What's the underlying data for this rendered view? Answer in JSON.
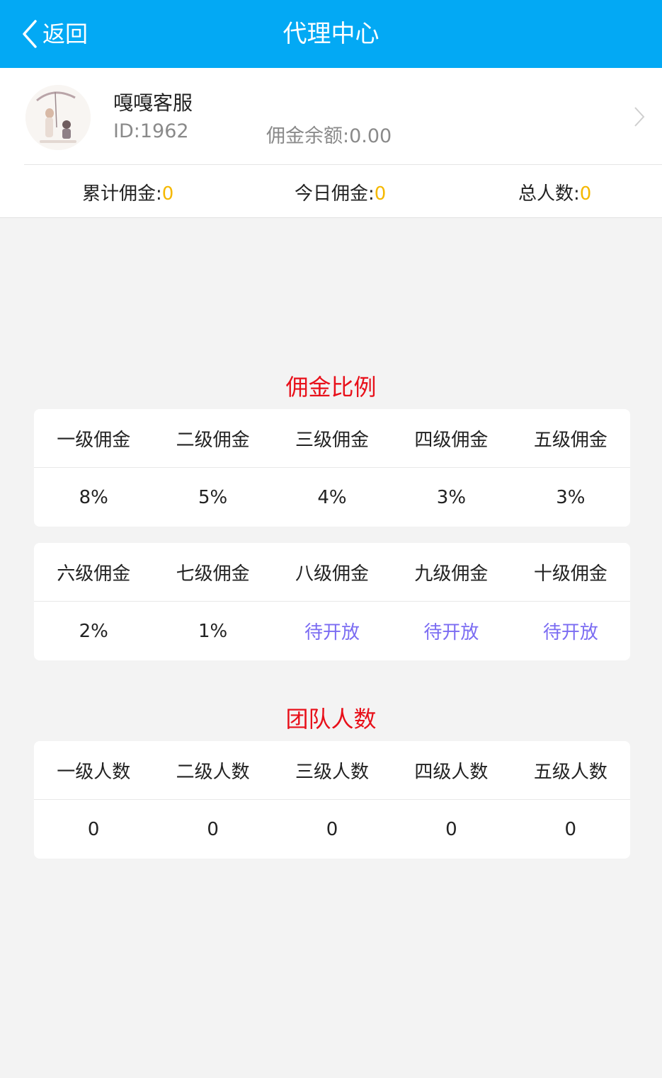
{
  "header": {
    "back_label": "返回",
    "title": "代理中心"
  },
  "profile": {
    "name": "嘎嘎客服",
    "id_text": "ID:1962",
    "balance_text": "佣金余额:0.00",
    "stats": [
      {
        "label": "累计佣金:",
        "value": "0"
      },
      {
        "label": "今日佣金:",
        "value": "0"
      },
      {
        "label": "总人数:",
        "value": "0"
      }
    ]
  },
  "commission": {
    "title": "佣金比例",
    "row1_headers": [
      "一级佣金",
      "二级佣金",
      "三级佣金",
      "四级佣金",
      "五级佣金"
    ],
    "row1_values": [
      "8%",
      "5%",
      "4%",
      "3%",
      "3%"
    ],
    "row2_headers": [
      "六级佣金",
      "七级佣金",
      "八级佣金",
      "九级佣金",
      "十级佣金"
    ],
    "row2_values": [
      "2%",
      "1%",
      "待开放",
      "待开放",
      "待开放"
    ]
  },
  "team": {
    "title": "团队人数",
    "headers": [
      "一级人数",
      "二级人数",
      "三级人数",
      "四级人数",
      "五级人数"
    ],
    "values": [
      "0",
      "0",
      "0",
      "0",
      "0"
    ]
  },
  "colors": {
    "header_bg": "#03a9f4",
    "stat_value": "#f5b800",
    "section_title": "#e8101a",
    "pending": "#7b6cf2"
  },
  "icons": [
    "back-chevron-icon",
    "avatar-image",
    "chevron-right-icon"
  ]
}
